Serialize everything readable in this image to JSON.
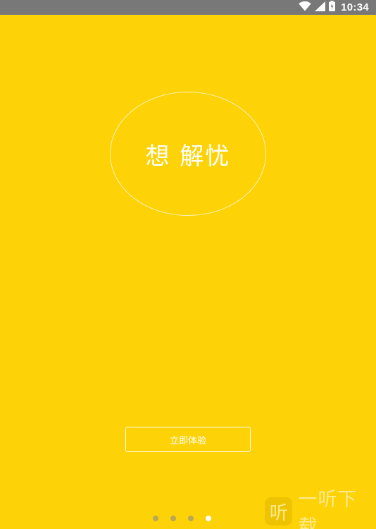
{
  "status_bar": {
    "time": "10:34",
    "icons": [
      "wifi-icon",
      "cell-signal-icon",
      "battery-icon"
    ]
  },
  "splash": {
    "slogan": "想 解忧",
    "cta_label": "立即体验",
    "page_indicator": {
      "total": 4,
      "active": 4
    }
  },
  "watermark": {
    "logo_char": "听",
    "text": "一听下载"
  },
  "colors": {
    "background": "#FDD206",
    "status_bar": "#787878",
    "foreground": "#FFFFFF"
  }
}
